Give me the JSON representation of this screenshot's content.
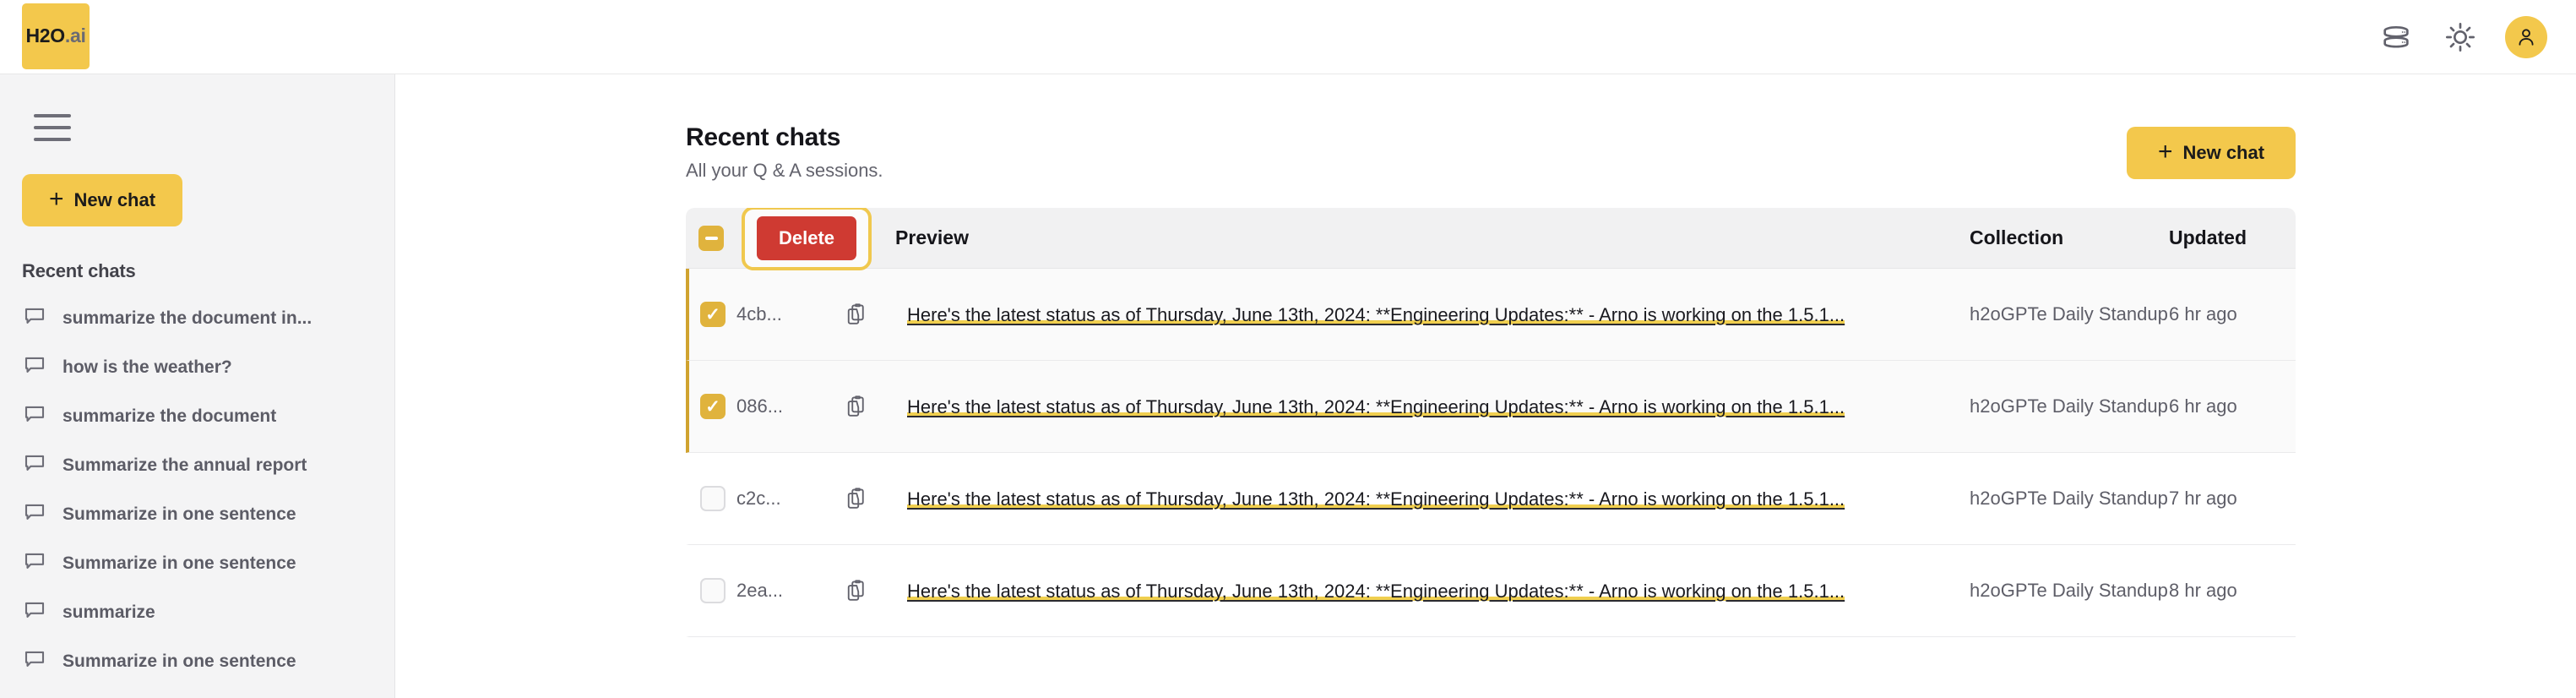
{
  "brand": {
    "name_primary": "H2O",
    "name_suffix": ".ai"
  },
  "topbar": {
    "icons": [
      {
        "name": "database-icon"
      },
      {
        "name": "sun-icon"
      },
      {
        "name": "avatar-icon"
      }
    ]
  },
  "sidebar": {
    "menu_icon": "hamburger-icon",
    "new_chat_label": "New chat",
    "new_chat_plus": "+",
    "section_title": "Recent chats",
    "items": [
      {
        "label": "summarize the document in..."
      },
      {
        "label": "how is the weather?"
      },
      {
        "label": "summarize the document"
      },
      {
        "label": "Summarize the annual report"
      },
      {
        "label": "Summarize in one sentence"
      },
      {
        "label": "Summarize in one sentence"
      },
      {
        "label": "summarize"
      },
      {
        "label": "Summarize in one sentence"
      }
    ]
  },
  "main": {
    "title": "Recent chats",
    "subtitle": "All your Q & A sessions.",
    "new_chat_label": "New chat",
    "new_chat_plus": "+",
    "toolbar": {
      "delete_label": "Delete"
    },
    "table": {
      "columns": {
        "preview": "Preview",
        "collection": "Collection",
        "updated": "Updated"
      },
      "header_checkbox_state": "indeterminate",
      "rows": [
        {
          "id": "4cb...",
          "selected": true,
          "preview": "Here's the latest status as of Thursday, June 13th, 2024: **Engineering Updates:** - Arno is working on the 1.5.1...",
          "collection": "h2oGPTe Daily Standup",
          "updated": "6 hr ago"
        },
        {
          "id": "086...",
          "selected": true,
          "preview": "Here's the latest status as of Thursday, June 13th, 2024: **Engineering Updates:** - Arno is working on the 1.5.1...",
          "collection": "h2oGPTe Daily Standup",
          "updated": "6 hr ago"
        },
        {
          "id": "c2c...",
          "selected": false,
          "preview": "Here's the latest status as of Thursday, June 13th, 2024: **Engineering Updates:** - Arno is working on the 1.5.1...",
          "collection": "h2oGPTe Daily Standup",
          "updated": "7 hr ago"
        },
        {
          "id": "2ea...",
          "selected": false,
          "preview": "Here's the latest status as of Thursday, June 13th, 2024: **Engineering Updates:** - Arno is working on the 1.5.1...",
          "collection": "h2oGPTe Daily Standup",
          "updated": "8 hr ago"
        }
      ]
    }
  },
  "colors": {
    "brand_yellow": "#f3c84c",
    "checkbox_gold": "#e0b33d",
    "selected_border": "#d0a32f",
    "delete_red": "#cf3a32",
    "focus_ring": "#f0c84e",
    "highlight_underline": "#f0cf4f"
  }
}
